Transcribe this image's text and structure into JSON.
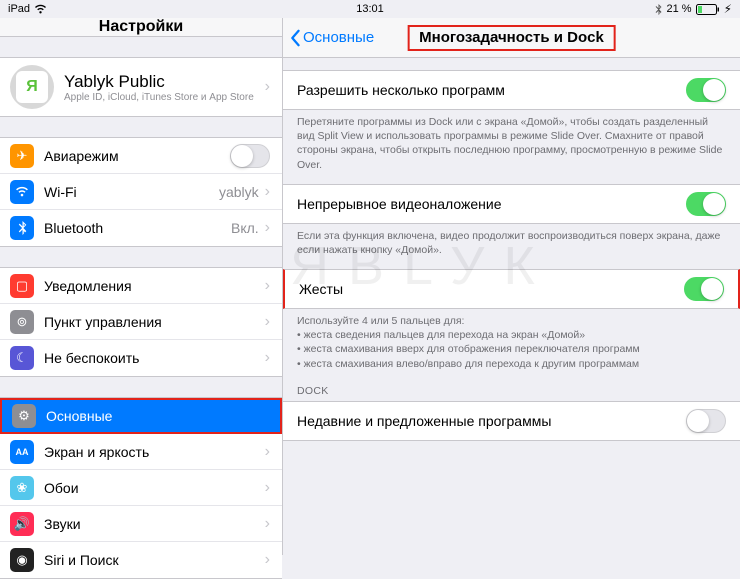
{
  "status": {
    "device": "iPad",
    "time": "13:01",
    "battery": "21 %"
  },
  "sidebar": {
    "title": "Настройки",
    "account": {
      "name": "Yablyk Public",
      "sub": "Apple ID, iCloud, iTunes Store и App Store"
    },
    "airplane": "Авиарежим",
    "wifi": {
      "label": "Wi-Fi",
      "value": "yablyk"
    },
    "bluetooth": {
      "label": "Bluetooth",
      "value": "Вкл."
    },
    "notifications": "Уведомления",
    "control": "Пункт управления",
    "dnd": "Не беспокоить",
    "general": "Основные",
    "display": "Экран и яркость",
    "wallpaper": "Обои",
    "sounds": "Звуки",
    "siri": "Siri и Поиск"
  },
  "detail": {
    "back": "Основные",
    "title": "Многозадачность и Dock",
    "allow_multiple": "Разрешить несколько программ",
    "allow_multiple_footer": "Перетяните программы из Dock или с экрана «Домой», чтобы создать разделенный вид Split View и использовать программы в режиме Slide Over. Смахните от правой стороны экрана, чтобы открыть последнюю программу, просмотренную в режиме Slide Over.",
    "pip": "Непрерывное видеоналожение",
    "pip_footer": "Если эта функция включена, видео продолжит воспроизводиться поверх экрана, даже если нажать кнопку «Домой».",
    "gestures": "Жесты",
    "gestures_header": "Используйте 4 или 5 пальцев для:",
    "gestures_b1": "жеста сведения пальцев для перехода на экран «Домой»",
    "gestures_b2": "жеста смахивания вверх для отображения переключателя программ",
    "gestures_b3": "жеста смахивания влево/вправо для перехода к другим программам",
    "dock_header": "DOCK",
    "recent": "Недавние и предложенные программы"
  }
}
